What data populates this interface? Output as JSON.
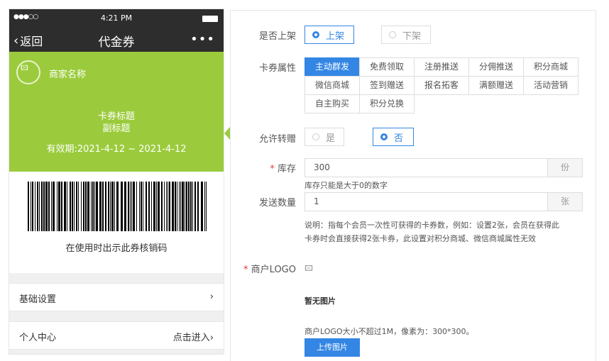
{
  "phone": {
    "status": {
      "signal": "●●●○○",
      "time": "4:21 PM"
    },
    "nav": {
      "back": "返回",
      "title": "代金券",
      "more": "•••"
    },
    "coupon": {
      "merchant": "商家名称",
      "title": "卡券标题",
      "subtitle": "副标题",
      "validity": "有效期:2021-4-12 ~ 2021-4-12",
      "color": "#9bcb3c"
    },
    "barcode_hint": "在使用时出示此券核销码",
    "menu": [
      {
        "label": "基础设置",
        "right": "›"
      },
      {
        "label": "个人中心",
        "right": "点击进入›"
      }
    ]
  },
  "form": {
    "shelf": {
      "label": "是否上架",
      "on": "上架",
      "off": "下架"
    },
    "attr": {
      "label": "卡券属性",
      "options": [
        [
          "主动群发",
          "免费领取",
          "注册推送",
          "分佣推送",
          "积分商城"
        ],
        [
          "微信商城",
          "签到赠送",
          "报名拓客",
          "满额赠送",
          "活动营销"
        ],
        [
          "自主购买",
          "积分兑换"
        ]
      ]
    },
    "transfer": {
      "label": "允许转赠",
      "yes": "是",
      "no": "否"
    },
    "stock": {
      "required": "*",
      "label": "库存",
      "value": "300",
      "unit": "份",
      "hint": "库存只能是大于0的数字"
    },
    "send": {
      "label": "发送数量",
      "value": "1",
      "unit": "张",
      "desc1": "说明：指每个会员一次性可获得的卡券数，例如：设置2张，会员在获得此",
      "desc2": "卡券时会直接获得2张卡券，此设置对积分商城、微信商城属性无效"
    },
    "logo": {
      "required": "*",
      "label": "商户LOGO",
      "no_image": "暂无图片",
      "hint": "商户LOGO大小不超过1M，像素为：300*300。",
      "upload": "上传图片"
    },
    "accent": "#3486e4"
  }
}
